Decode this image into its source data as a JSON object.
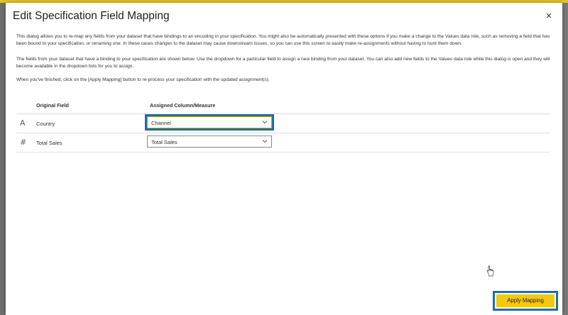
{
  "dialog": {
    "title": "Edit Specification Field Mapping",
    "close_glyph": "×",
    "description": [
      "This dialog allows you to re-map any fields from your dataset that have bindings to an encoding in your specification. You might also be automatically presented with these options if you make a change to the Values data role, such as removing a field that has been bound to your specification, or renaming one. In these cases changes to the dataset may cause downstream issues, so you can use this screen to easily make re-assignments without having to hunt them down.",
      "The fields from your dataset that have a binding to your specification are shown below. Use the dropdown for a particular field to assign a new binding from your dataset. You can also add new fields to the Values data role while this dialog is open and they will become available in the dropdown lists for you to assign.",
      "When you've finished, click on the [Apply Mapping] button to re-process your specification with the updated assignment(s)."
    ]
  },
  "table": {
    "headers": {
      "original": "Original Field",
      "assigned": "Assigned Column/Measure"
    },
    "rows": [
      {
        "type_icon": "A",
        "type_icon_name": "text-type-icon",
        "field": "Country",
        "assigned": "Channel"
      },
      {
        "type_icon": "#",
        "type_icon_name": "numeric-type-icon",
        "field": "Total Sales",
        "assigned": "Total Sales"
      }
    ]
  },
  "actions": {
    "apply_label": "Apply Mapping"
  },
  "colors": {
    "accent_yellow": "#f2c811",
    "highlight_blue": "#1a6fb0",
    "dialog_bg": "#ffffff",
    "overlay": "#8a8a8a"
  }
}
